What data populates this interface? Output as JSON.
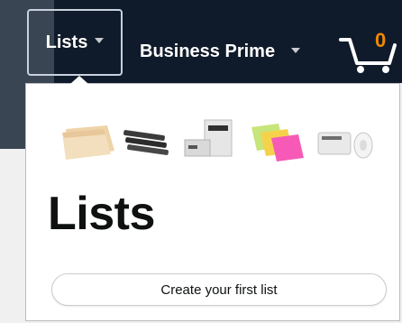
{
  "nav": {
    "lists_label": "Lists",
    "business_prime_label": "Business Prime",
    "cart_count": "0"
  },
  "panel": {
    "title": "Lists",
    "create_button_label": "Create your first list",
    "product_icons": [
      "folders-icon",
      "staples-icon",
      "printer-icon",
      "sticky-notes-icon",
      "label-printer-icon"
    ]
  },
  "colors": {
    "nav_bg": "#0f1b2a",
    "accent_orange": "#f08804",
    "text_dark": "#0f1111"
  }
}
